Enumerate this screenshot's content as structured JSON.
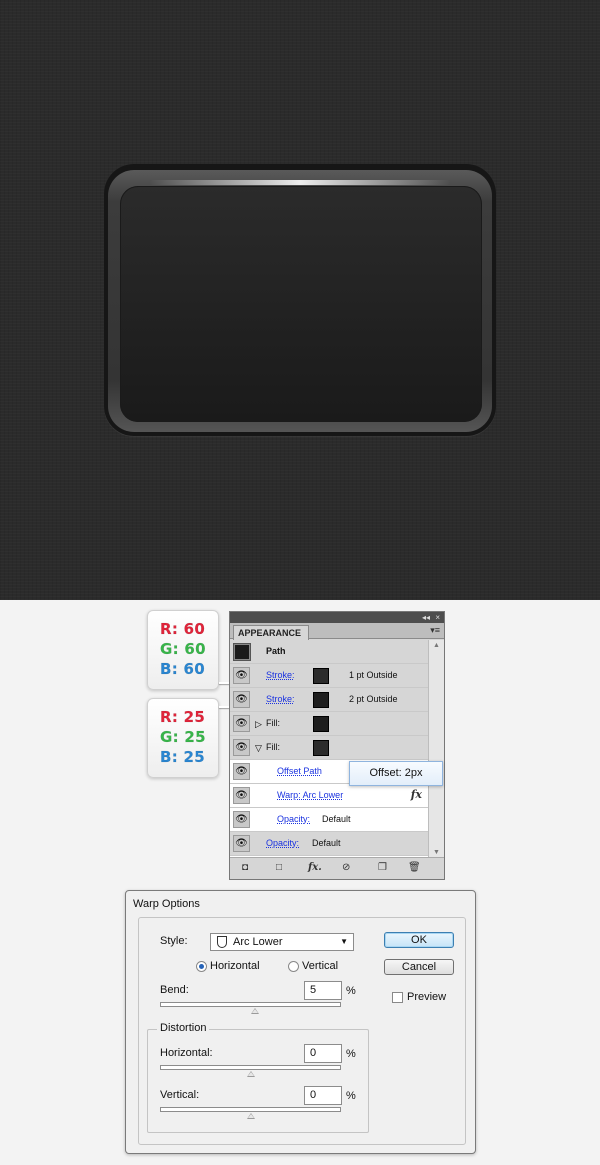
{
  "swatches": [
    {
      "r": "R: 60",
      "g": "G: 60",
      "b": "B: 60"
    },
    {
      "r": "R: 25",
      "g": "G: 25",
      "b": "B: 25"
    }
  ],
  "appearance": {
    "window_controls": "◂◂",
    "close_control": "×",
    "tab": "APPEARANCE",
    "menu_icon": "menu-icon",
    "rows": {
      "path": "Path",
      "stroke1": {
        "label": "Stroke:",
        "value": "1 pt  Outside"
      },
      "stroke2": {
        "label": "Stroke:",
        "value": "2 pt  Outside"
      },
      "fill1": {
        "label": "Fill:"
      },
      "fill2": {
        "label": "Fill:"
      },
      "offset_path": "Offset Path",
      "warp": "Warp: Arc Lower",
      "fx": "fx",
      "opacity_inner": {
        "label": "Opacity:",
        "value": "Default"
      },
      "opacity_outer": {
        "label": "Opacity:",
        "value": "Default"
      }
    },
    "tooltip": "Offset: 2px"
  },
  "warp_options": {
    "title": "Warp Options",
    "style_label": "Style:",
    "style_value": "Arc Lower",
    "orientation": {
      "horizontal": "Horizontal",
      "vertical": "Vertical",
      "selected": "Horizontal"
    },
    "bend_label": "Bend:",
    "bend_value": "5",
    "percent": "%",
    "distortion_label": "Distortion",
    "horizontal_label": "Horizontal:",
    "horizontal_value": "0",
    "vertical_label": "Vertical:",
    "vertical_value": "0",
    "ok": "OK",
    "cancel": "Cancel",
    "preview": "Preview",
    "preview_checked": false,
    "bend_slider_fraction": 0.525,
    "horizontal_slider_fraction": 0.5,
    "vertical_slider_fraction": 0.5
  },
  "colors": {
    "red": "#e0243a",
    "green": "#38b54a",
    "blue": "#2a86d1",
    "link": "#1a32e0"
  }
}
